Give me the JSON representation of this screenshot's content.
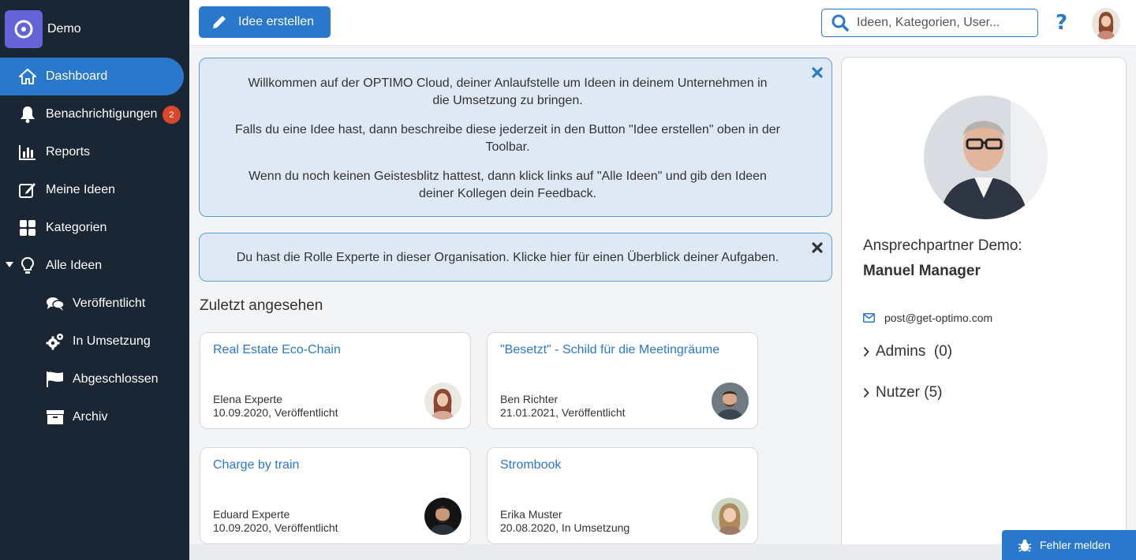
{
  "brand": {
    "name": "Demo"
  },
  "sidebar": {
    "items": [
      {
        "label": "Dashboard",
        "icon": "home-icon",
        "active": true
      },
      {
        "label": "Benachrichtigungen",
        "icon": "bell-icon",
        "badge": "2"
      },
      {
        "label": "Reports",
        "icon": "bar-chart-icon"
      },
      {
        "label": "Meine Ideen",
        "icon": "edit-icon"
      },
      {
        "label": "Kategorien",
        "icon": "grid-icon"
      },
      {
        "label": "Alle Ideen",
        "icon": "lightbulb-icon",
        "expanded": true
      },
      {
        "label": "Veröffentlicht",
        "icon": "comments-icon",
        "sub": true
      },
      {
        "label": "In Umsetzung",
        "icon": "gears-icon",
        "sub": true
      },
      {
        "label": "Abgeschlossen",
        "icon": "flag-icon",
        "sub": true
      },
      {
        "label": "Archiv",
        "icon": "archive-icon",
        "sub": true
      }
    ]
  },
  "toolbar": {
    "create_label": "Idee erstellen",
    "search_placeholder": "Ideen, Kategorien, User...",
    "help_label": "?"
  },
  "welcome_banner": {
    "p1": "Willkommen auf der OPTIMO Cloud, deiner Anlaufstelle um Ideen in deinem Unternehmen in die Umsetzung zu bringen.",
    "p2": "Falls du eine Idee hast, dann beschreibe diese jederzeit in den Button \"Idee erstellen\" oben in der Toolbar.",
    "p3": "Wenn du noch keinen Geistesblitz hattest, dann klick links auf \"Alle Ideen\" und gib den Ideen deiner Kollegen dein Feedback."
  },
  "role_banner": {
    "text": "Du hast die Rolle Experte in dieser Organisation. Klicke hier für einen Überblick deiner Aufgaben."
  },
  "recent": {
    "title": "Zuletzt angesehen",
    "cards": [
      {
        "title": "Real Estate Eco-Chain",
        "author": "Elena Experte",
        "meta": "10.09.2020, Veröffentlicht"
      },
      {
        "title": "\"Besetzt\" - Schild für die Meetingräume",
        "author": "Ben Richter",
        "meta": "21.01.2021, Veröffentlicht"
      },
      {
        "title": "Charge by train",
        "author": "Eduard Experte",
        "meta": "10.09.2020, Veröffentlicht"
      },
      {
        "title": "Strombook",
        "author": "Erika Muster",
        "meta": "20.08.2020, In Umsetzung"
      }
    ]
  },
  "contact": {
    "label": "Ansprechpartner Demo:",
    "name": "Manuel Manager",
    "email": "post@get-optimo.com",
    "groups": [
      {
        "label": "Admins  (0)"
      },
      {
        "label": "Nutzer (5)"
      }
    ]
  },
  "bug_report": {
    "label": "Fehler melden"
  },
  "colors": {
    "accent": "#2a78cc",
    "sidebar": "#1b2634",
    "badge": "#d9472b",
    "banner_bg": "#dfe8f5"
  }
}
